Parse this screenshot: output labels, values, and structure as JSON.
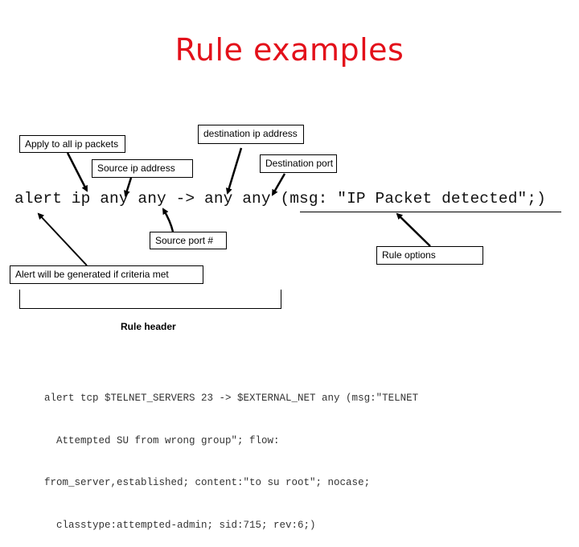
{
  "title": "Rule examples",
  "title_color": "#e3101a",
  "rule": {
    "text": "alert ip any any -> any any (msg: \"IP Packet detected\";)"
  },
  "labels": {
    "apply_all_ip": "Apply to all ip packets",
    "destination_ip": "destination ip address",
    "source_ip": "Source ip address",
    "destination_port": "Destination port",
    "source_port": "Source port #",
    "rule_options": "Rule options",
    "alert_generated": "Alert will be generated if criteria met",
    "rule_header": "Rule header"
  },
  "example_rule": {
    "lines": [
      "alert tcp $TELNET_SERVERS 23 -> $EXTERNAL_NET any (msg:\"TELNET",
      "  Attempted SU from wrong group\"; flow:",
      "from_server,established; content:\"to su root\"; nocase;",
      "  classtype:attempted-admin; sid:715; rev:6;)"
    ]
  }
}
